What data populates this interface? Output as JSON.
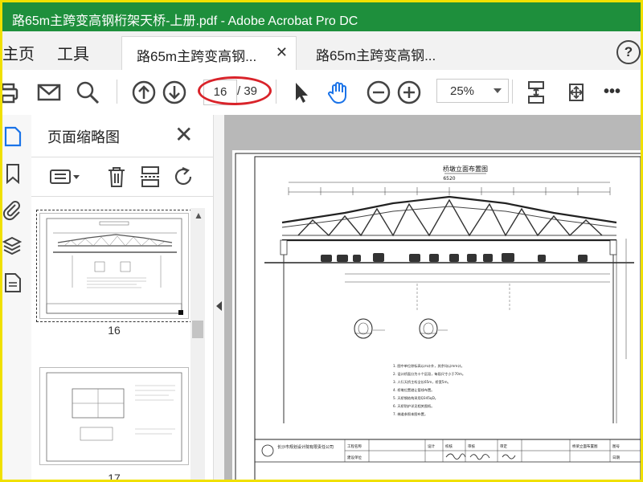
{
  "window": {
    "title": "路65m主跨变高钢桁架天桥-上册.pdf - Adobe Acrobat Pro DC"
  },
  "menu": {
    "home": "主页",
    "tools": "工具"
  },
  "tabs": [
    {
      "label": "路65m主跨变高钢...",
      "active": true
    },
    {
      "label": "路65m主跨变高钢...",
      "active": false
    }
  ],
  "help_label": "?",
  "toolbar": {
    "current_page": "16",
    "total_pages": "/ 39",
    "zoom": "25%",
    "more": "•••"
  },
  "thumbnails_panel": {
    "title": "页面缩略图",
    "pages": [
      {
        "label": "16",
        "selected": true
      },
      {
        "label": "17",
        "selected": false
      }
    ]
  },
  "drawing": {
    "title": "桥墩立面布置图",
    "top_dim": "6520",
    "notes": [
      "1. 图中单位除标高以m计外，其余均以mm计。",
      "2. 设计桥面分为十个区段，每段尺寸小于70m。",
      "3. 人行天桥主桁全长65m，桥宽5m。",
      "4. 桥墩位置避让管线布置。",
      "5. 天桥钢结构采用Q345qD。",
      "6. 天桥防护详见相关图纸。",
      "7. 梯道参照本图布置。"
    ],
    "company": "长沙市规划设计院有限责任公司",
    "title_block": [
      "工程名称",
      "建设单位",
      "设计",
      "校核",
      "审核",
      "审定",
      "桥梁立面布置图",
      "图号",
      "日期"
    ]
  },
  "colors": {
    "titlebar": "#1e8f3c",
    "highlight": "#d9232a",
    "hand_tool": "#1a73e8"
  }
}
